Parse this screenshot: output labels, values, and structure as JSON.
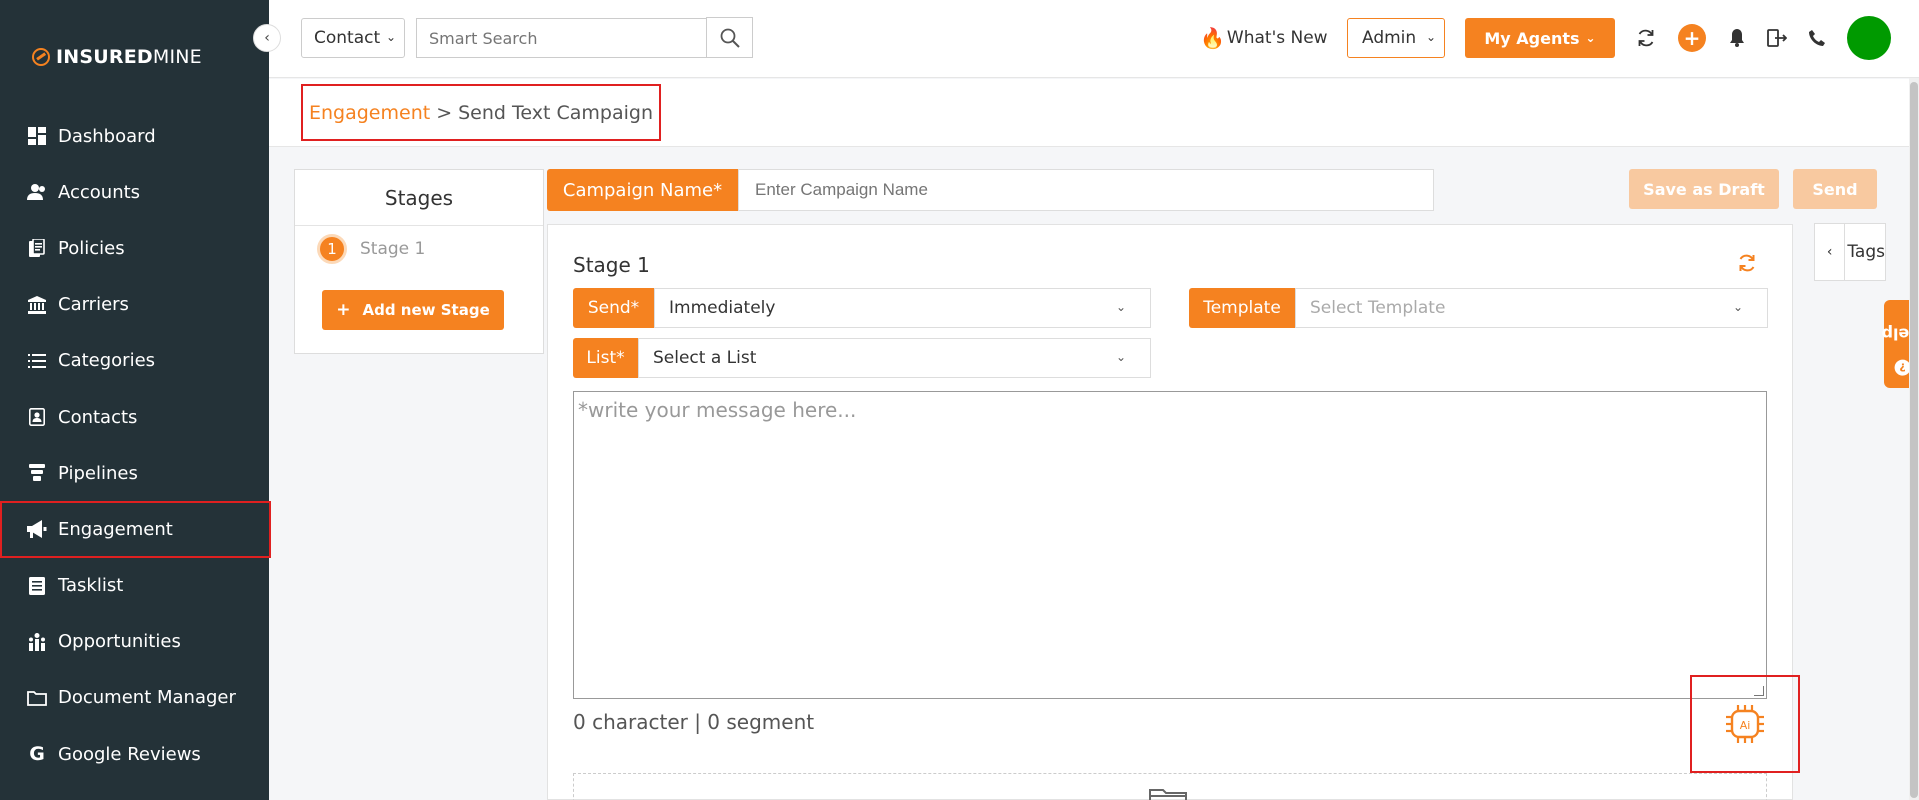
{
  "brand": {
    "name_bold": "INSURED",
    "name_light": "MINE"
  },
  "sidebar": {
    "items": [
      {
        "label": "Dashboard",
        "icon": "dashboard-icon"
      },
      {
        "label": "Accounts",
        "icon": "accounts-icon"
      },
      {
        "label": "Policies",
        "icon": "policies-icon"
      },
      {
        "label": "Carriers",
        "icon": "carriers-icon"
      },
      {
        "label": "Categories",
        "icon": "categories-icon"
      },
      {
        "label": "Contacts",
        "icon": "contacts-icon"
      },
      {
        "label": "Pipelines",
        "icon": "pipelines-icon"
      },
      {
        "label": "Engagement",
        "icon": "megaphone-icon",
        "active": true
      },
      {
        "label": "Tasklist",
        "icon": "tasklist-icon"
      },
      {
        "label": "Opportunities",
        "icon": "opportunities-icon"
      },
      {
        "label": "Document Manager",
        "icon": "folder-icon"
      },
      {
        "label": "Google Reviews",
        "icon": "google-icon"
      }
    ]
  },
  "topbar": {
    "scope_select": "Contact",
    "search_placeholder": "Smart Search",
    "whats_new": "What's New",
    "role_select": "Admin",
    "agents_button": "My Agents",
    "plus_label": "+"
  },
  "breadcrumb": {
    "parent": "Engagement",
    "separator": ">",
    "current": "Send Text Campaign"
  },
  "stages_panel": {
    "title": "Stages",
    "items": [
      {
        "number": "1",
        "label": "Stage 1"
      }
    ],
    "add_button": "Add new Stage"
  },
  "campaign": {
    "name_label": "Campaign Name*",
    "name_placeholder": "Enter Campaign Name",
    "save_draft": "Save as Draft",
    "send": "Send"
  },
  "stage_form": {
    "heading": "Stage 1",
    "send_label": "Send*",
    "send_value": "Immediately",
    "template_label": "Template",
    "template_placeholder": "Select Template",
    "list_label": "List*",
    "list_value": "Select a List",
    "message_placeholder": "*write your message here...",
    "counter": "0 character | 0 segment",
    "ai_label": "Ai"
  },
  "tags_panel": {
    "label": "Tags"
  },
  "help_tab": {
    "label": "Help",
    "icon_glyph": "?"
  },
  "colors": {
    "accent": "#f58220",
    "sidebar_bg": "#243238",
    "highlight_red": "#e02020",
    "avatar": "#009a00"
  }
}
